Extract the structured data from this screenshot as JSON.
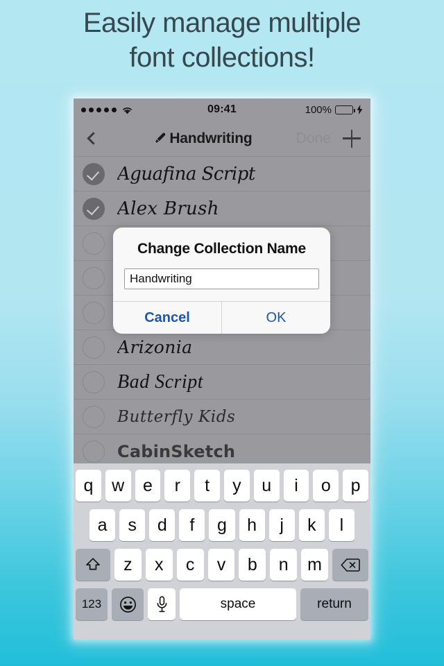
{
  "promo": {
    "headline_line1": "Easily manage multiple",
    "headline_line2": "font collections!",
    "bg_top_color": "#b3e7f2",
    "bg_bottom_color": "#22bed9",
    "text_color": "#37474f"
  },
  "status_bar": {
    "signal_dots": 5,
    "wifi_icon": "wifi-icon",
    "time": "09:41",
    "battery_percent": "100%",
    "battery_color": "#4ee34e",
    "charging_icon": "⚡"
  },
  "nav_bar": {
    "back_icon": "chevron-left-icon",
    "title_icon": "pencil-icon",
    "title": "Handwriting",
    "done_label": "Done",
    "add_icon": "plus-icon",
    "background": "#9a9a9e"
  },
  "font_list": {
    "rows": [
      {
        "name": "Aguafina Script",
        "selected": true,
        "style": "script"
      },
      {
        "name": "Alex Brush",
        "selected": true,
        "style": "brush"
      },
      {
        "name": "",
        "selected": false,
        "style": "script"
      },
      {
        "name": "",
        "selected": false,
        "style": "script"
      },
      {
        "name": "",
        "selected": false,
        "style": "script"
      },
      {
        "name": "Arizonia",
        "selected": false,
        "style": "arizonia"
      },
      {
        "name": "Bad Script",
        "selected": false,
        "style": "badscript"
      },
      {
        "name": "Butterfly Kids",
        "selected": false,
        "style": "butterfly"
      },
      {
        "name": "CabinSketch",
        "selected": false,
        "style": "cabinsketch"
      }
    ]
  },
  "alert": {
    "title": "Change Collection Name",
    "input_value": "Handwriting",
    "input_placeholder": "",
    "cancel_label": "Cancel",
    "ok_label": "OK",
    "accent_color": "#1b56b4"
  },
  "keyboard": {
    "row1": [
      "q",
      "w",
      "e",
      "r",
      "t",
      "y",
      "u",
      "i",
      "o",
      "p"
    ],
    "row2": [
      "a",
      "s",
      "d",
      "f",
      "g",
      "h",
      "j",
      "k",
      "l"
    ],
    "row3": [
      "z",
      "x",
      "c",
      "v",
      "b",
      "n",
      "m"
    ],
    "shift_icon": "shift-icon",
    "backspace_icon": "backspace-icon",
    "numbers_label": "123",
    "emoji_icon": "emoji-icon",
    "mic_icon": "microphone-icon",
    "space_label": "space",
    "return_label": "return",
    "background": "#d0d2d8"
  }
}
